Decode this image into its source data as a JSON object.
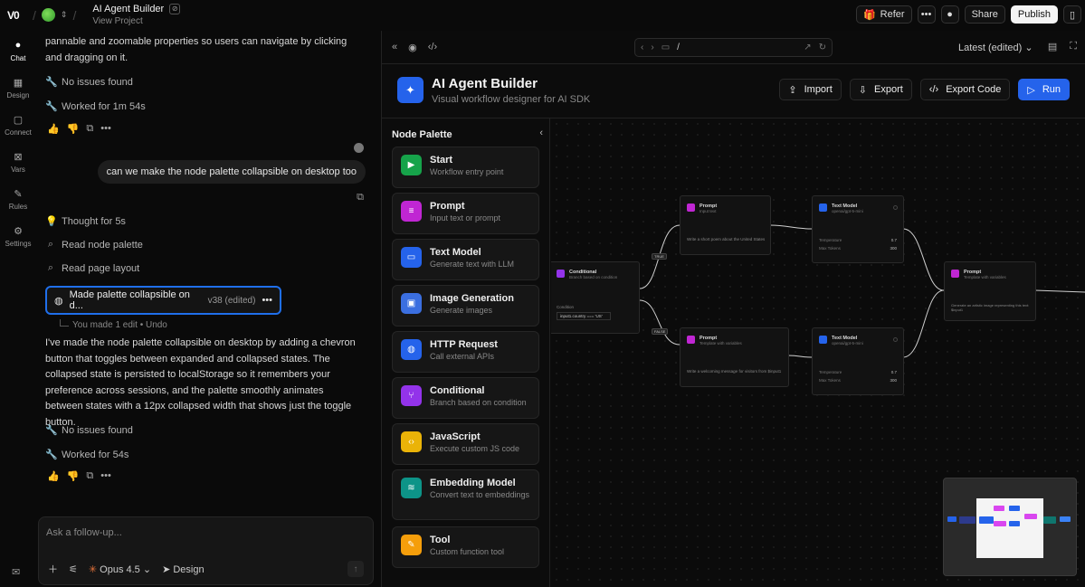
{
  "topbar": {
    "logo": "V0",
    "project_title": "AI Agent Builder",
    "project_sub": "View Project",
    "refer": "Refer",
    "share": "Share",
    "publish": "Publish"
  },
  "rail": [
    {
      "label": "Chat",
      "icon": "chat-icon"
    },
    {
      "label": "Design",
      "icon": "design-icon"
    },
    {
      "label": "Connect",
      "icon": "connect-icon"
    },
    {
      "label": "Vars",
      "icon": "vars-icon"
    },
    {
      "label": "Rules",
      "icon": "rules-icon"
    },
    {
      "label": "Settings",
      "icon": "settings-icon"
    }
  ],
  "chat": {
    "prev_text": "pannable and zoomable properties so users can navigate by clicking and dragging on it.",
    "no_issues_1": "No issues found",
    "worked_1": "Worked for 1m 54s",
    "user_message": "can we make the node palette collapsible on desktop too",
    "thought": "Thought for 5s",
    "read_1": "Read node palette",
    "read_2": "Read page layout",
    "edit_label": "Made palette collapsible on d...",
    "edit_version": "v38 (edited)",
    "undo_text": "You made 1 edit • Undo",
    "response": "I've made the node palette collapsible on desktop by adding a chevron button that toggles between expanded and collapsed states. The collapsed state is persisted to localStorage so it remembers your preference across sessions, and the palette smoothly animates between states with a 12px collapsed width that shows just the toggle button.",
    "no_issues_2": "No issues found",
    "worked_2": "Worked for 54s",
    "input_placeholder": "Ask a follow-up...",
    "model": "Opus 4.5",
    "design": "Design"
  },
  "preview": {
    "url_path": "/",
    "version": "Latest (edited)",
    "app_title": "AI Agent Builder",
    "app_subtitle": "Visual workflow designer for AI SDK",
    "import": "Import",
    "export": "Export",
    "export_code": "Export Code",
    "run": "Run",
    "palette_title": "Node Palette",
    "palette": [
      {
        "name": "Start",
        "desc": "Workflow entry point",
        "color": "#16a34a",
        "glyph": "▶"
      },
      {
        "name": "Prompt",
        "desc": "Input text or prompt",
        "color": "#c026d3",
        "glyph": "≡"
      },
      {
        "name": "Text Model",
        "desc": "Generate text with LLM",
        "color": "#2563eb",
        "glyph": "▭"
      },
      {
        "name": "Image Generation",
        "desc": "Generate images",
        "color": "#3b6fe0",
        "glyph": "▣"
      },
      {
        "name": "HTTP Request",
        "desc": "Call external APIs",
        "color": "#2563eb",
        "glyph": "◍"
      },
      {
        "name": "Conditional",
        "desc": "Branch based on condition",
        "color": "#9333ea",
        "glyph": "⑂"
      },
      {
        "name": "JavaScript",
        "desc": "Execute custom JS code",
        "color": "#eab308",
        "glyph": "‹›"
      },
      {
        "name": "Embedding Model",
        "desc": "Convert text to embeddings",
        "color": "#0d9488",
        "glyph": "≋"
      },
      {
        "name": "Tool",
        "desc": "Custom function tool",
        "color": "#f59e0b",
        "glyph": "✎"
      }
    ],
    "nodes": {
      "conditional": {
        "title": "Conditional",
        "sub": "Branch based on condition",
        "label": "Condition",
        "value": "input1.country === 'US'"
      },
      "prompt1": {
        "title": "Prompt",
        "sub": "Input text",
        "body": "Write a short poem about the United States"
      },
      "prompt2": {
        "title": "Prompt",
        "sub": "Template with variables",
        "body": "Write a welcoming message for visitors from $input1"
      },
      "model1": {
        "title": "Text Model",
        "sub": "openai/gpt-5-mini",
        "k1": "Temperature",
        "v1": "0.7",
        "k2": "Max Tokens",
        "v2": "300"
      },
      "model2": {
        "title": "Text Model",
        "sub": "openai/gpt-5-mini",
        "k1": "Temperature",
        "v1": "0.7",
        "k2": "Max Tokens",
        "v2": "300"
      },
      "prompt3": {
        "title": "Prompt",
        "sub": "Template with variables",
        "body": "Generate an artistic image representing this text: $input1"
      },
      "true_label": "TRUE",
      "false_label": "FALSE"
    }
  }
}
